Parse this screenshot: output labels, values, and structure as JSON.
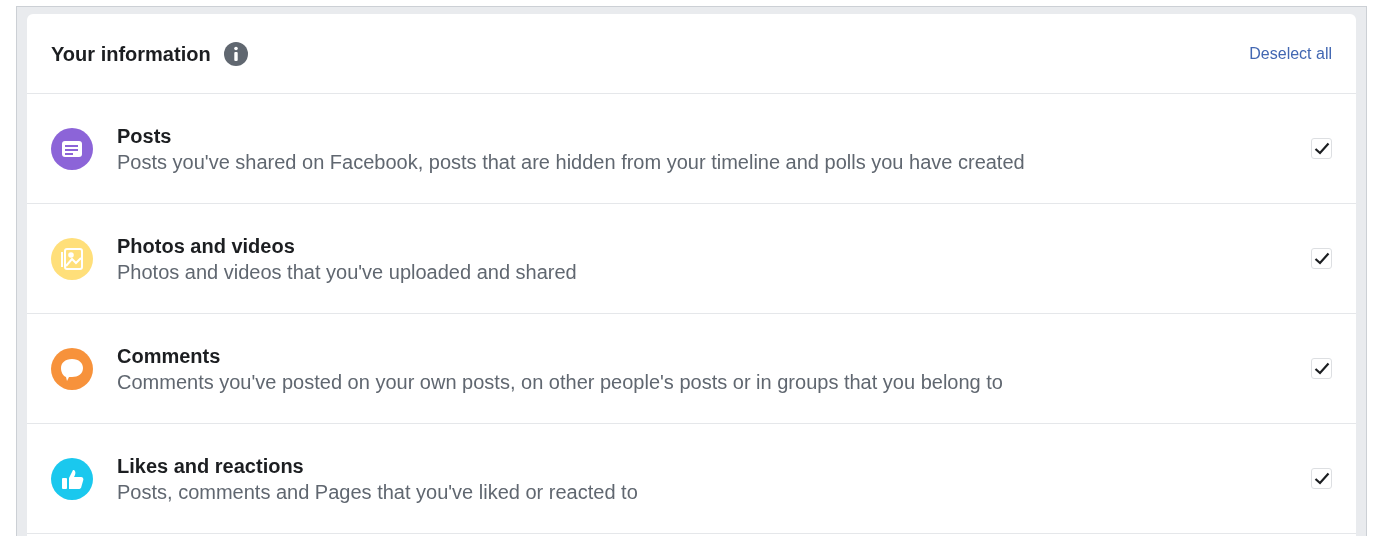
{
  "header": {
    "title": "Your information",
    "action": "Deselect all"
  },
  "categories": [
    {
      "kind": "posts",
      "color": "#8c64d8",
      "title": "Posts",
      "description": "Posts you've shared on Facebook, posts that are hidden from your timeline and polls you have created",
      "checked": true
    },
    {
      "kind": "photos",
      "color": "#ffdf7a",
      "title": "Photos and videos",
      "description": "Photos and videos that you've uploaded and shared",
      "checked": true
    },
    {
      "kind": "comments",
      "color": "#f7923b",
      "title": "Comments",
      "description": "Comments you've posted on your own posts, on other people's posts or in groups that you belong to",
      "checked": true
    },
    {
      "kind": "likes",
      "color": "#1ac8ee",
      "title": "Likes and reactions",
      "description": "Posts, comments and Pages that you've liked or reacted to",
      "checked": true
    }
  ]
}
